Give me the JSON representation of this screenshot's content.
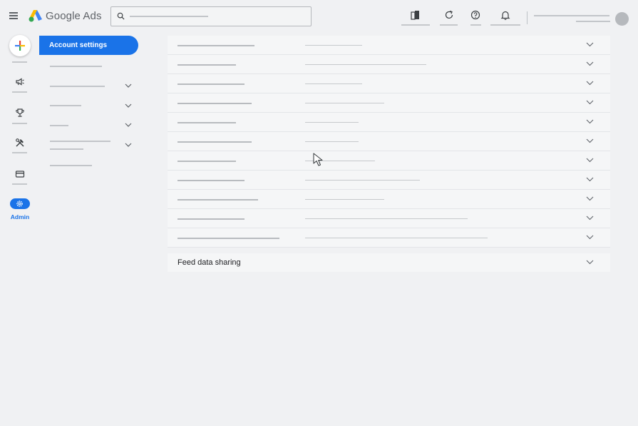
{
  "header": {
    "brand": "Google Ads"
  },
  "icons": {
    "menu": "hamburger-icon",
    "logo": "google-ads-logo",
    "search": "search-icon",
    "tools": [
      "building-icon",
      "refresh-icon",
      "help-icon",
      "bell-icon"
    ]
  },
  "rail": {
    "admin_label": "Admin"
  },
  "settings_nav": {
    "active_item": "Account settings"
  },
  "panel": {
    "rows": [
      {
        "l1": 108,
        "l2": 80
      },
      {
        "l1": 82,
        "l2": 170
      },
      {
        "l1": 94,
        "l2": 80
      },
      {
        "l1": 104,
        "l2": 111
      },
      {
        "l1": 82,
        "l2": 75
      },
      {
        "l1": 104,
        "l2": 75
      },
      {
        "l1": 82,
        "l2": 98
      },
      {
        "l1": 94,
        "l2": 161
      },
      {
        "l1": 113,
        "l2": 111
      },
      {
        "l1": 94,
        "l2": 228
      },
      {
        "l1": 143,
        "l2": 256
      }
    ],
    "feed_label": "Feed data sharing"
  },
  "colors": {
    "accent": "#1a73e8",
    "background": "#f0f1f3"
  }
}
